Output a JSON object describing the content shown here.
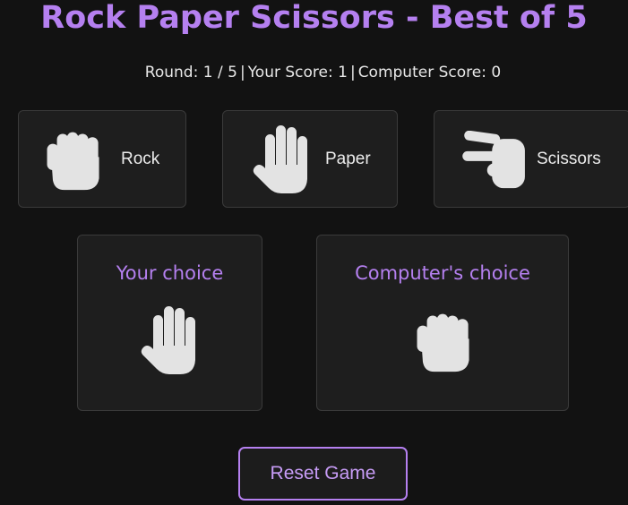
{
  "title": "Rock Paper Scissors - Best of 5",
  "status": {
    "round_label": "Round:",
    "round_current": "1",
    "round_total": "5",
    "your_score_label": "Your Score:",
    "your_score": "1",
    "computer_score_label": "Computer Score:",
    "computer_score": "0"
  },
  "choices": [
    {
      "label": "Rock",
      "icon": "fist-icon"
    },
    {
      "label": "Paper",
      "icon": "open-hand-icon"
    },
    {
      "label": "Scissors",
      "icon": "victory-hand-icon"
    }
  ],
  "panels": {
    "player": {
      "title": "Your choice",
      "icon": "open-hand-icon"
    },
    "computer": {
      "title": "Computer's choice",
      "icon": "fist-icon"
    }
  },
  "reset_label": "Reset Game",
  "colors": {
    "accent": "#b580f0",
    "background": "#121212",
    "card": "#1e1e1e",
    "icon": "#e3e3e3"
  }
}
